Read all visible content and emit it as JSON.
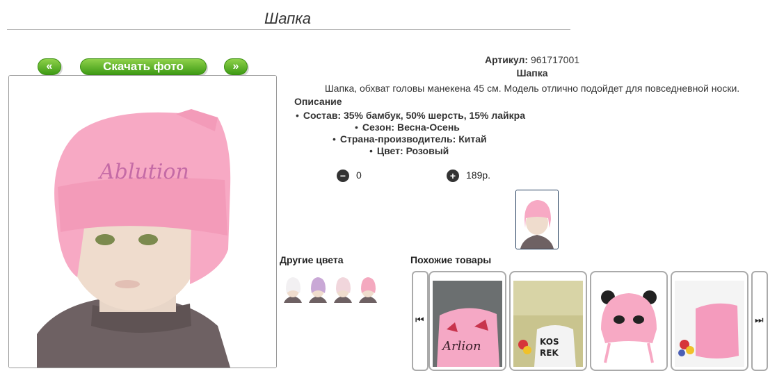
{
  "page": {
    "title": "Шапка"
  },
  "photo_nav": {
    "prev_label": "«",
    "download_label": "Скачать фото",
    "next_label": "»"
  },
  "product": {
    "article_label": "Артикул:",
    "article_value": "961717001",
    "name": "Шапка",
    "description": "Шапка, обхват головы манекена 45 см. Модель отлично подойдет для повседневной носки.",
    "description_heading": "Описание",
    "properties": [
      "Состав: 35% бамбук, 50% шерсть, 15% лайкра",
      "Сезон: Весна-Осень",
      "Страна-производитель: Китай",
      "Цвет: Розовый"
    ]
  },
  "cart": {
    "quantity": "0",
    "price": "189р."
  },
  "other_colors": {
    "heading": "Другие цвета",
    "colors": [
      "#f2f0f2",
      "#c9a8d6",
      "#f1d6dc",
      "#f4a9bf"
    ]
  },
  "similar": {
    "heading": "Похожие товары"
  },
  "colors": {
    "button_green": "#56b020",
    "hat_pink": "#f7a9c4",
    "border": "#aaaaaa"
  }
}
